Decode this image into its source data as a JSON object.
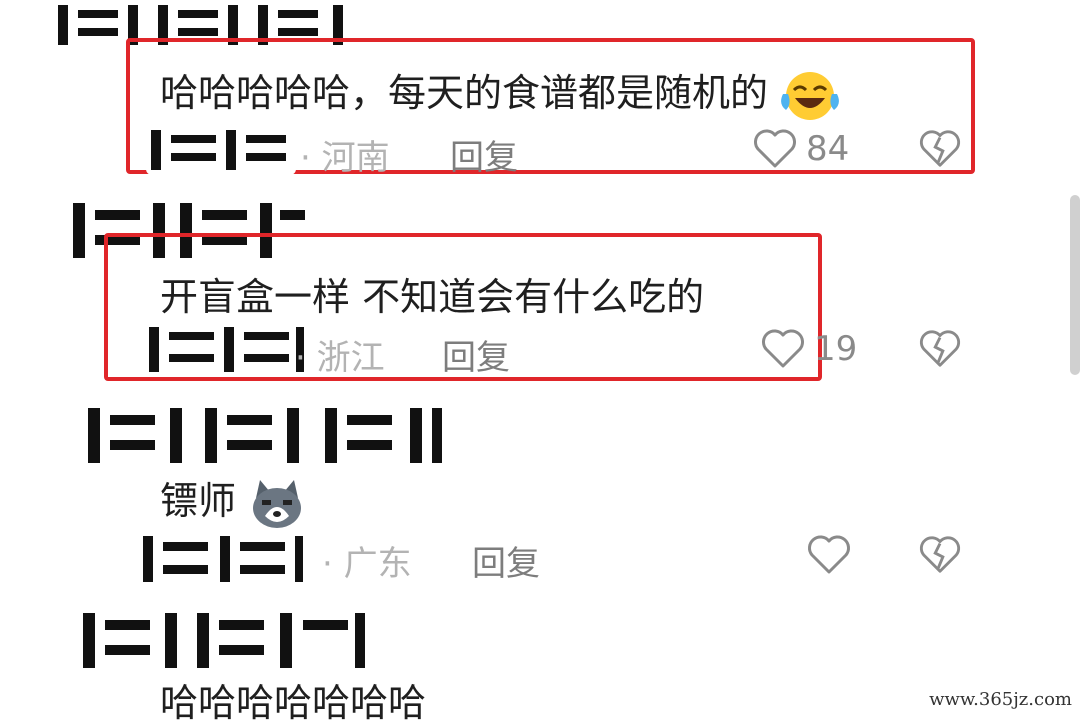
{
  "comments": [
    {
      "text": "哈哈哈哈哈，每天的食谱都是随机的",
      "emoji": "laughing-with-tears",
      "location": "· 河南",
      "reply_label": "回复",
      "likes": "84",
      "highlighted": true
    },
    {
      "text": "开盲盒一样 不知道会有什么吃的",
      "location": "· 浙江",
      "reply_label": "回复",
      "likes": "19",
      "highlighted": true
    },
    {
      "text": "镖师",
      "emoji": "husky-dog",
      "location": "· 广东",
      "reply_label": "回复",
      "likes": "",
      "highlighted": false
    },
    {
      "text": "哈哈哈哈哈哈哈"
    }
  ],
  "colors": {
    "highlight_border": "#e0262a",
    "meta_gray": "#b3b3b3"
  },
  "watermark": "www.365jz.com"
}
